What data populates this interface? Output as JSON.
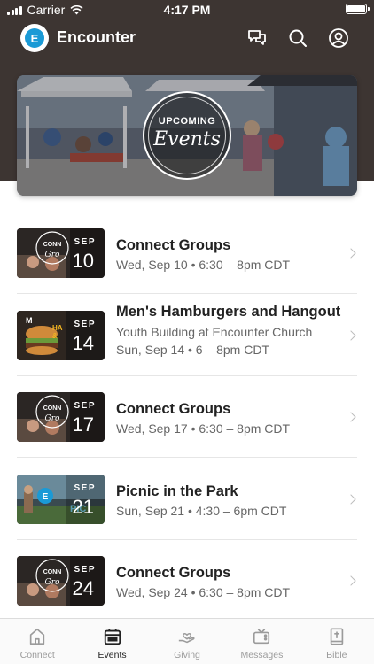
{
  "status_bar": {
    "carrier": "Carrier",
    "time": "4:17 PM"
  },
  "app_bar": {
    "logo_letter": "E",
    "title": "Encounter",
    "icons": [
      "messages-icon",
      "search-icon",
      "profile-icon"
    ]
  },
  "hero": {
    "top_text": "UPCOMING",
    "script_text": "Events"
  },
  "events": [
    {
      "title": "Connect Groups",
      "subtitle": "",
      "datetime": "Wed, Sep 10 • 6:30 – 8pm CDT",
      "month": "SEP",
      "day": "10",
      "thumb": "connect"
    },
    {
      "title": "Men's Hamburgers and Hangout",
      "subtitle": "Youth Building at Encounter Church",
      "datetime": "Sun, Sep 14 • 6 – 8pm CDT",
      "month": "SEP",
      "day": "14",
      "thumb": "burger"
    },
    {
      "title": "Connect Groups",
      "subtitle": "",
      "datetime": "Wed, Sep 17 • 6:30 – 8pm CDT",
      "month": "SEP",
      "day": "17",
      "thumb": "connect"
    },
    {
      "title": "Picnic in the Park",
      "subtitle": "",
      "datetime": "Sun, Sep 21 • 4:30 – 6pm CDT",
      "month": "SEP",
      "day": "21",
      "thumb": "picnic"
    },
    {
      "title": "Connect Groups",
      "subtitle": "",
      "datetime": "Wed, Sep 24 • 6:30 – 8pm CDT",
      "month": "SEP",
      "day": "24",
      "thumb": "connect"
    }
  ],
  "tabs": [
    {
      "label": "Connect",
      "icon": "home-icon",
      "active": false
    },
    {
      "label": "Events",
      "icon": "calendar-icon",
      "active": true
    },
    {
      "label": "Giving",
      "icon": "giving-hand-icon",
      "active": false
    },
    {
      "label": "Messages",
      "icon": "tv-icon",
      "active": false
    },
    {
      "label": "Bible",
      "icon": "bible-icon",
      "active": false
    }
  ],
  "colors": {
    "header_bg": "#3d3532",
    "accent": "#1a9ad6",
    "active_tab": "#222222",
    "inactive_tab": "#9b9b9b"
  }
}
